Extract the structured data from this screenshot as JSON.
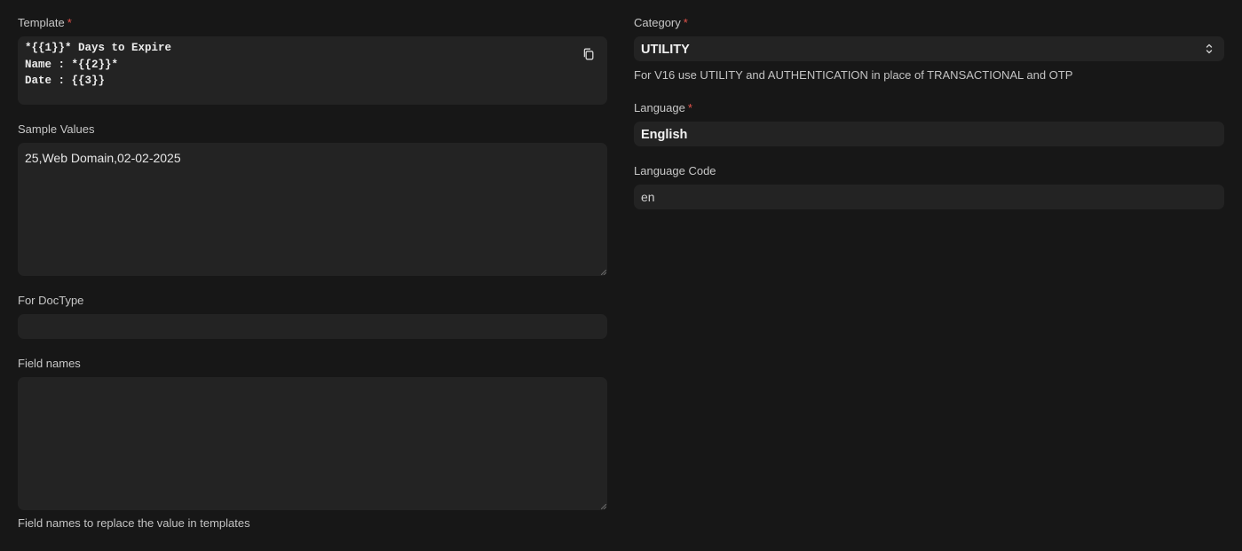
{
  "template": {
    "label": "Template",
    "required_mark": "*",
    "lines": [
      "*{{1}}* Days to Expire",
      "Name : *{{2}}*",
      "Date : {{3}}"
    ]
  },
  "sample_values": {
    "label": "Sample Values",
    "value": "25,Web Domain,02-02-2025"
  },
  "for_doctype": {
    "label": "For DocType",
    "value": ""
  },
  "field_names": {
    "label": "Field names",
    "value": "",
    "help": "Field names to replace the value in templates"
  },
  "category": {
    "label": "Category",
    "required_mark": "*",
    "value": "UTILITY",
    "help": "For V16 use UTILITY and AUTHENTICATION in place of TRANSACTIONAL and OTP"
  },
  "language": {
    "label": "Language",
    "required_mark": "*",
    "value": "English"
  },
  "language_code": {
    "label": "Language Code",
    "value": "en"
  },
  "icons": {
    "copy": "copy-icon",
    "select_caret": "chevron-up-down-icon",
    "resize": "resize-grip-icon"
  }
}
